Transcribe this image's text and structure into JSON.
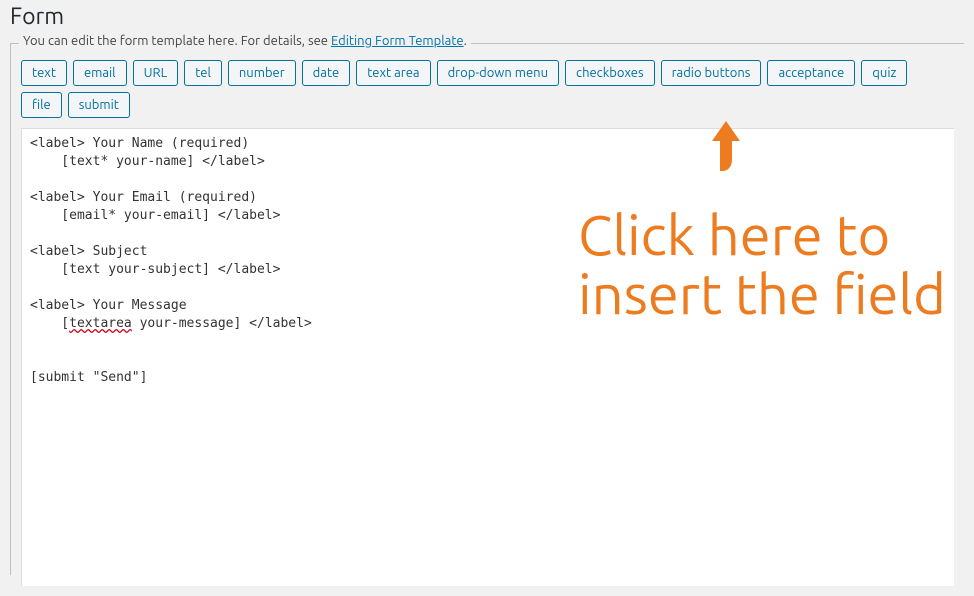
{
  "heading": "Form",
  "legend": {
    "prefix": "You can edit the form template here. For details, see ",
    "link_text": "Editing Form Template",
    "suffix": "."
  },
  "tag_buttons": [
    "text",
    "email",
    "URL",
    "tel",
    "number",
    "date",
    "text area",
    "drop-down menu",
    "checkboxes",
    "radio buttons",
    "acceptance",
    "quiz",
    "file",
    "submit"
  ],
  "editor": {
    "line1": "<label> Your Name (required)",
    "line2": "    [text* your-name] </label>",
    "line3": "<label> Your Email (required)",
    "line4": "    [email* your-email] </label>",
    "line5": "<label> Subject",
    "line6": "    [text your-subject] </label>",
    "line7": "<label> Your Message",
    "line8a": "    [",
    "line8err": "textarea",
    "line8b": " your-message] </label>",
    "line9": "[submit \"Send\"]"
  },
  "annotation": {
    "text": "Click here to insert the field",
    "color": "#ed7b1f"
  }
}
